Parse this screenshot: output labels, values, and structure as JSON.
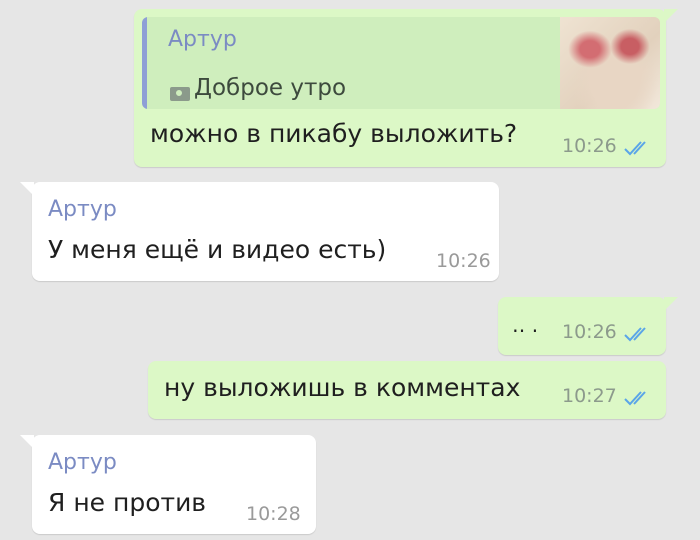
{
  "messages": [
    {
      "quote": {
        "sender": "Артур",
        "text": "Доброе утро",
        "media_icon": "camera-icon"
      },
      "text": "можно в пикабу выложить?",
      "time": "10:26",
      "status": "read"
    },
    {
      "sender": "Артур",
      "text": "У меня ещё и видео есть)",
      "time": "10:26"
    },
    {
      "text": "‥ .",
      "time": "10:26",
      "status": "read"
    },
    {
      "text": "ну выложишь в комментах",
      "time": "10:27",
      "status": "read"
    },
    {
      "sender": "Артур",
      "text": "Я не против",
      "time": "10:28"
    }
  ],
  "colors": {
    "background": "#e6e6e6",
    "outgoing_bubble": "#dcf8c6",
    "incoming_bubble": "#ffffff",
    "sender_name": "#7b8bc3",
    "read_ticks": "#5aa5e8"
  }
}
